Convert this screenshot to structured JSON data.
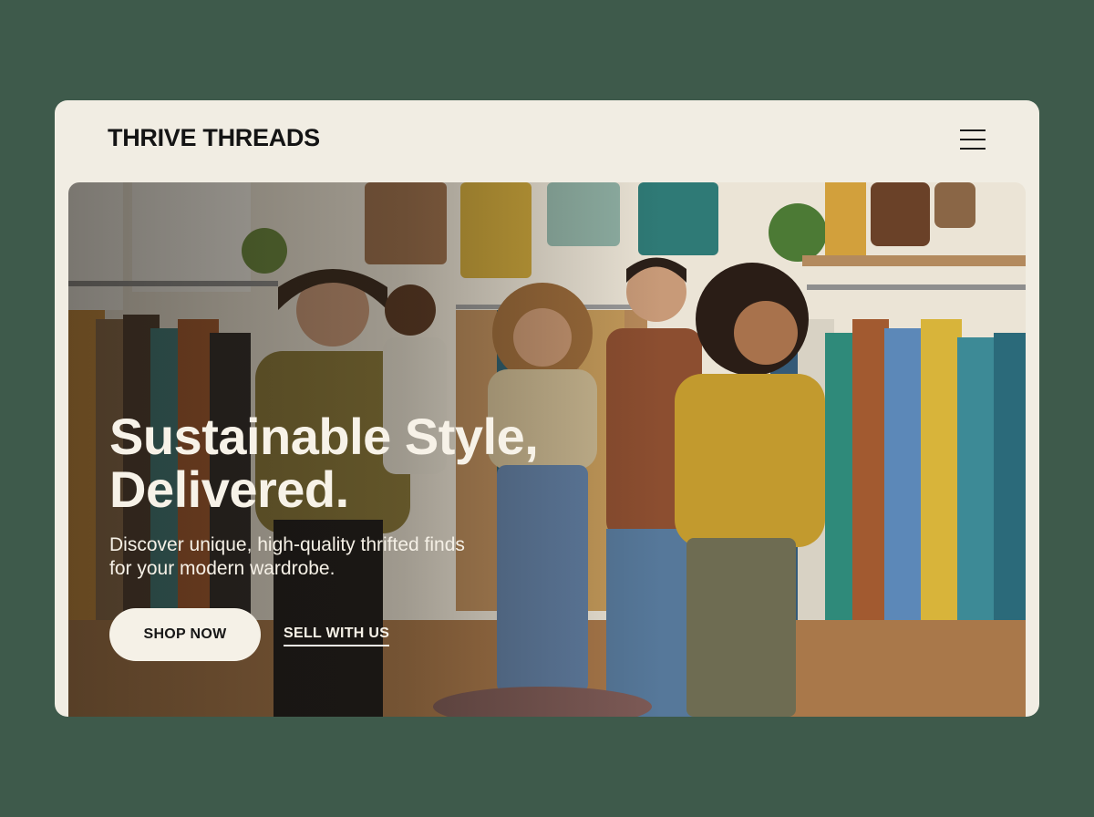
{
  "brand": {
    "name": "THRIVE THREADS"
  },
  "header": {
    "menu_icon": "hamburger-menu-icon"
  },
  "hero": {
    "headline_line1": "Sustainable Style,",
    "headline_line2": "Delivered.",
    "subtext_line1": "Discover unique, high-quality thrifted finds",
    "subtext_line2": "for your modern wardrobe.",
    "image_description_icon": "thrift-store-photo"
  },
  "actions": {
    "primary_label": "SHOP NOW",
    "secondary_label": "SELL WITH US"
  },
  "colors": {
    "page_background": "#3e5a4b",
    "card_background": "#f1ede3",
    "button_background": "#f5f1e7",
    "text_light": "#f7f2e8",
    "text_dark": "#141414"
  }
}
